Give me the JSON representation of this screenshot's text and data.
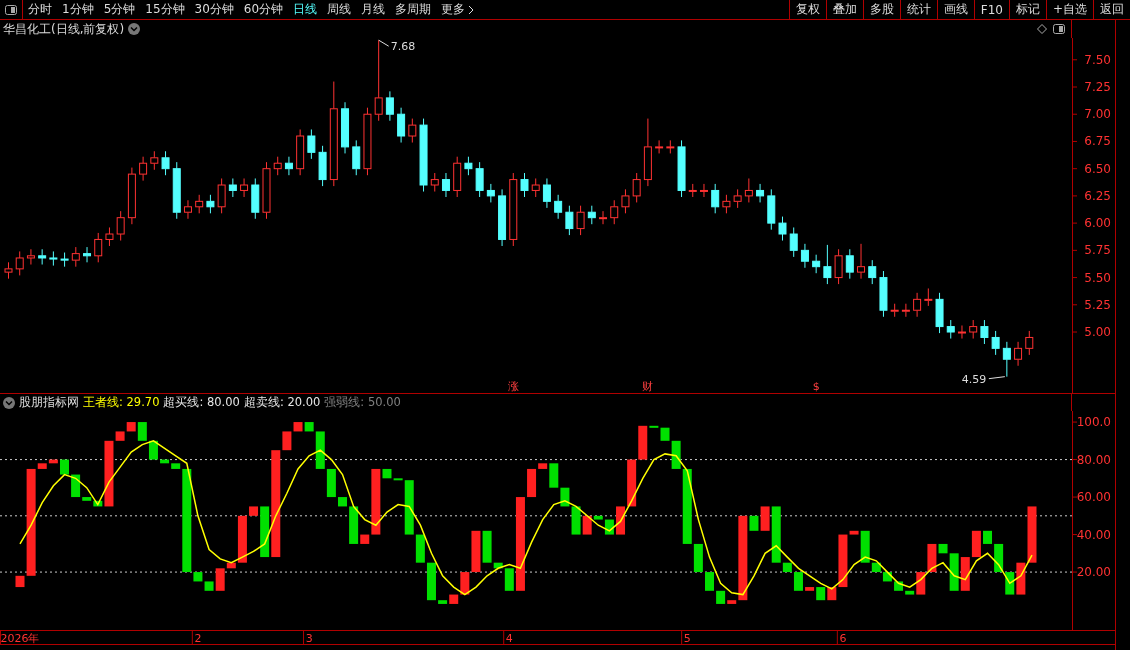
{
  "toolbar": {
    "periods": [
      {
        "label": "分时",
        "selected": false
      },
      {
        "label": "1分钟",
        "selected": false
      },
      {
        "label": "5分钟",
        "selected": false
      },
      {
        "label": "15分钟",
        "selected": false
      },
      {
        "label": "30分钟",
        "selected": false
      },
      {
        "label": "60分钟",
        "selected": false
      },
      {
        "label": "日线",
        "selected": true
      },
      {
        "label": "周线",
        "selected": false
      },
      {
        "label": "月线",
        "selected": false
      },
      {
        "label": "多周期",
        "selected": false
      },
      {
        "label": "更多",
        "selected": false
      }
    ],
    "buttons": [
      "复权",
      "叠加",
      "多股",
      "统计",
      "画线",
      "F10",
      "标记",
      "+自选",
      "返回"
    ]
  },
  "price_panel": {
    "title": "华昌化工(日线,前复权)",
    "high_label": "7.68",
    "low_label": "4.59",
    "events": [
      "涨",
      "财",
      "$"
    ],
    "chart_data": {
      "type": "candlestick",
      "ylim": [
        4.44,
        7.7
      ],
      "yticks": [
        {
          "value": 7.5,
          "label": "7.50"
        },
        {
          "value": 7.25,
          "label": "7.25"
        },
        {
          "value": 7.0,
          "label": "7.00"
        },
        {
          "value": 6.75,
          "label": "6.75"
        },
        {
          "value": 6.5,
          "label": "6.50"
        },
        {
          "value": 6.25,
          "label": "6.25"
        },
        {
          "value": 6.0,
          "label": "6.00"
        },
        {
          "value": 5.75,
          "label": "5.75"
        },
        {
          "value": 5.5,
          "label": "5.50"
        },
        {
          "value": 5.25,
          "label": "5.25"
        },
        {
          "value": 5.0,
          "label": "5.00"
        }
      ],
      "categories": [
        null,
        null,
        null,
        null,
        null,
        null,
        null,
        null,
        null,
        null,
        null,
        null,
        null,
        null,
        null,
        null,
        null,
        null,
        null,
        null,
        null,
        null,
        null,
        null,
        null,
        null,
        null,
        null,
        null,
        null,
        null,
        null,
        null,
        null,
        null,
        null,
        null,
        null,
        null,
        null,
        null,
        null,
        null,
        null,
        null,
        null,
        null,
        null,
        null,
        null,
        null,
        null,
        null,
        null,
        null,
        null,
        null,
        null,
        null,
        null,
        null,
        null,
        null,
        null,
        null,
        null,
        null,
        null,
        null,
        null,
        null,
        null,
        null,
        null,
        null,
        null,
        null,
        null,
        null,
        null,
        null,
        null,
        null,
        null,
        null,
        null,
        null,
        null,
        null,
        null,
        null,
        null
      ],
      "ohlc": [
        [
          5.55,
          5.64,
          5.49,
          5.58
        ],
        [
          5.58,
          5.74,
          5.52,
          5.68
        ],
        [
          5.68,
          5.76,
          5.62,
          5.7
        ],
        [
          5.7,
          5.76,
          5.62,
          5.68
        ],
        [
          5.68,
          5.74,
          5.61,
          5.67
        ],
        [
          5.67,
          5.73,
          5.6,
          5.66
        ],
        [
          5.66,
          5.78,
          5.6,
          5.72
        ],
        [
          5.72,
          5.78,
          5.64,
          5.7
        ],
        [
          5.7,
          5.91,
          5.64,
          5.85
        ],
        [
          5.85,
          5.96,
          5.79,
          5.9
        ],
        [
          5.9,
          6.11,
          5.84,
          6.05
        ],
        [
          6.05,
          6.51,
          5.99,
          6.45
        ],
        [
          6.45,
          6.61,
          6.39,
          6.55
        ],
        [
          6.55,
          6.66,
          6.49,
          6.6
        ],
        [
          6.6,
          6.66,
          6.44,
          6.5
        ],
        [
          6.5,
          6.56,
          6.04,
          6.1
        ],
        [
          6.1,
          6.21,
          6.04,
          6.15
        ],
        [
          6.15,
          6.26,
          6.09,
          6.2
        ],
        [
          6.2,
          6.26,
          6.09,
          6.15
        ],
        [
          6.15,
          6.41,
          6.09,
          6.35
        ],
        [
          6.35,
          6.41,
          6.24,
          6.3
        ],
        [
          6.3,
          6.41,
          6.24,
          6.35
        ],
        [
          6.35,
          6.41,
          6.04,
          6.1
        ],
        [
          6.1,
          6.56,
          6.04,
          6.5
        ],
        [
          6.5,
          6.61,
          6.44,
          6.55
        ],
        [
          6.55,
          6.61,
          6.44,
          6.5
        ],
        [
          6.5,
          6.86,
          6.44,
          6.8
        ],
        [
          6.8,
          6.86,
          6.59,
          6.65
        ],
        [
          6.65,
          6.71,
          6.34,
          6.4
        ],
        [
          6.4,
          7.3,
          6.34,
          7.05
        ],
        [
          7.05,
          7.11,
          6.64,
          6.7
        ],
        [
          6.7,
          6.76,
          6.44,
          6.5
        ],
        [
          6.5,
          7.06,
          6.44,
          7.0
        ],
        [
          7.0,
          7.68,
          6.94,
          7.15
        ],
        [
          7.15,
          7.21,
          6.94,
          7.0
        ],
        [
          7.0,
          7.06,
          6.74,
          6.8
        ],
        [
          6.8,
          6.96,
          6.74,
          6.9
        ],
        [
          6.9,
          6.96,
          6.29,
          6.35
        ],
        [
          6.35,
          6.46,
          6.29,
          6.4
        ],
        [
          6.4,
          6.46,
          6.24,
          6.3
        ],
        [
          6.3,
          6.61,
          6.24,
          6.55
        ],
        [
          6.55,
          6.61,
          6.44,
          6.5
        ],
        [
          6.5,
          6.56,
          6.24,
          6.3
        ],
        [
          6.3,
          6.36,
          6.19,
          6.25
        ],
        [
          6.25,
          6.31,
          5.79,
          5.85
        ],
        [
          5.85,
          6.46,
          5.79,
          6.4
        ],
        [
          6.4,
          6.46,
          6.24,
          6.3
        ],
        [
          6.3,
          6.41,
          6.24,
          6.35
        ],
        [
          6.35,
          6.41,
          6.14,
          6.2
        ],
        [
          6.2,
          6.26,
          6.04,
          6.1
        ],
        [
          6.1,
          6.16,
          5.89,
          5.95
        ],
        [
          5.95,
          6.16,
          5.89,
          6.1
        ],
        [
          6.1,
          6.16,
          5.99,
          6.05
        ],
        [
          6.05,
          6.11,
          5.99,
          6.05
        ],
        [
          6.05,
          6.21,
          5.99,
          6.15
        ],
        [
          6.15,
          6.31,
          6.09,
          6.25
        ],
        [
          6.25,
          6.46,
          6.19,
          6.4
        ],
        [
          6.4,
          6.96,
          6.34,
          6.7
        ],
        [
          6.7,
          6.76,
          6.64,
          6.7
        ],
        [
          6.7,
          6.76,
          6.64,
          6.7
        ],
        [
          6.7,
          6.76,
          6.24,
          6.3
        ],
        [
          6.3,
          6.36,
          6.24,
          6.3
        ],
        [
          6.3,
          6.36,
          6.24,
          6.3
        ],
        [
          6.3,
          6.36,
          6.09,
          6.15
        ],
        [
          6.15,
          6.26,
          6.09,
          6.2
        ],
        [
          6.2,
          6.31,
          6.14,
          6.25
        ],
        [
          6.25,
          6.41,
          6.19,
          6.3
        ],
        [
          6.3,
          6.36,
          6.19,
          6.25
        ],
        [
          6.25,
          6.31,
          5.94,
          6.0
        ],
        [
          6.0,
          6.06,
          5.84,
          5.9
        ],
        [
          5.9,
          5.96,
          5.69,
          5.75
        ],
        [
          5.75,
          5.81,
          5.59,
          5.65
        ],
        [
          5.65,
          5.71,
          5.54,
          5.6
        ],
        [
          5.6,
          5.8,
          5.44,
          5.5
        ],
        [
          5.5,
          5.76,
          5.44,
          5.7
        ],
        [
          5.7,
          5.76,
          5.49,
          5.55
        ],
        [
          5.55,
          5.81,
          5.49,
          5.6
        ],
        [
          5.6,
          5.66,
          5.44,
          5.5
        ],
        [
          5.5,
          5.56,
          5.14,
          5.2
        ],
        [
          5.2,
          5.26,
          5.14,
          5.2
        ],
        [
          5.2,
          5.26,
          5.14,
          5.2
        ],
        [
          5.2,
          5.36,
          5.14,
          5.3
        ],
        [
          5.3,
          5.4,
          5.24,
          5.3
        ],
        [
          5.3,
          5.36,
          4.99,
          5.05
        ],
        [
          5.05,
          5.11,
          4.94,
          5.0
        ],
        [
          5.0,
          5.06,
          4.94,
          5.0
        ],
        [
          5.0,
          5.11,
          4.94,
          5.05
        ],
        [
          5.05,
          5.11,
          4.89,
          4.95
        ],
        [
          4.95,
          5.01,
          4.79,
          4.85
        ],
        [
          4.85,
          4.91,
          4.59,
          4.75
        ],
        [
          4.75,
          4.91,
          4.69,
          4.85
        ],
        [
          4.85,
          5.01,
          4.79,
          4.95
        ]
      ]
    }
  },
  "indicator_panel": {
    "name": "股朋指标网",
    "readings": [
      {
        "label": "王者线: 29.70",
        "color": "#ffff00"
      },
      {
        "label": "超买线: 80.00",
        "color": "#e6e6e6"
      },
      {
        "label": "超卖线: 20.00",
        "color": "#e6e6e6"
      },
      {
        "label": "强弱线: 50.00",
        "color": "#808080"
      }
    ],
    "chart_data": {
      "type": "candlestick",
      "ylim": [
        -10.9,
        105.9
      ],
      "yticks": [
        {
          "value": 100,
          "label": "100.0"
        },
        {
          "value": 80,
          "label": "80.00"
        },
        {
          "value": 60,
          "label": "60.00"
        },
        {
          "value": 40,
          "label": "40.00"
        },
        {
          "value": 20,
          "label": "20.00"
        }
      ],
      "ref_lines": [
        {
          "axis": "y",
          "value": 80
        },
        {
          "axis": "y",
          "value": 50
        },
        {
          "axis": "y",
          "value": 20
        }
      ],
      "categories": [
        "2026年",
        null,
        null,
        null,
        null,
        null,
        null,
        null,
        null,
        null,
        null,
        null,
        null,
        null,
        null,
        null,
        "2",
        null,
        null,
        null,
        null,
        null,
        null,
        null,
        null,
        null,
        "3",
        null,
        null,
        null,
        null,
        null,
        null,
        null,
        null,
        null,
        null,
        null,
        null,
        null,
        null,
        null,
        null,
        null,
        "4",
        null,
        null,
        null,
        null,
        null,
        null,
        null,
        null,
        null,
        null,
        null,
        null,
        null,
        null,
        null,
        "5",
        null,
        null,
        null,
        null,
        null,
        null,
        null,
        null,
        null,
        null,
        null,
        null,
        null,
        "6",
        null,
        null,
        null,
        null,
        null,
        null,
        null,
        null,
        null,
        null,
        null,
        null,
        null,
        null,
        null,
        null,
        null
      ],
      "ohlc": [
        [
          12,
          18,
          12,
          18
        ],
        [
          18,
          75,
          18,
          75
        ],
        [
          75,
          78,
          75,
          78
        ],
        [
          78,
          80,
          78,
          80
        ],
        [
          80,
          80,
          72,
          72
        ],
        [
          72,
          72,
          60,
          60
        ],
        [
          60,
          60,
          58,
          58
        ],
        [
          58,
          58,
          55,
          55
        ],
        [
          55,
          90,
          55,
          90
        ],
        [
          90,
          95,
          90,
          95
        ],
        [
          95,
          100,
          95,
          100
        ],
        [
          100,
          100,
          90,
          90
        ],
        [
          90,
          90,
          80,
          80
        ],
        [
          80,
          80,
          78,
          78
        ],
        [
          78,
          78,
          75,
          75
        ],
        [
          75,
          75,
          20,
          20
        ],
        [
          20,
          20,
          15,
          15
        ],
        [
          15,
          15,
          10,
          10
        ],
        [
          10,
          22,
          10,
          22
        ],
        [
          22,
          25,
          22,
          25
        ],
        [
          25,
          50,
          25,
          50
        ],
        [
          50,
          55,
          50,
          55
        ],
        [
          55,
          55,
          28,
          28
        ],
        [
          28,
          85,
          28,
          85
        ],
        [
          85,
          95,
          85,
          95
        ],
        [
          95,
          100,
          95,
          100
        ],
        [
          100,
          100,
          95,
          95
        ],
        [
          95,
          95,
          75,
          75
        ],
        [
          75,
          75,
          60,
          60
        ],
        [
          60,
          60,
          55,
          55
        ],
        [
          55,
          55,
          35,
          35
        ],
        [
          35,
          40,
          35,
          40
        ],
        [
          40,
          75,
          40,
          75
        ],
        [
          75,
          75,
          70,
          70
        ],
        [
          70,
          70,
          69,
          69
        ],
        [
          69,
          69,
          40,
          40
        ],
        [
          40,
          40,
          25,
          25
        ],
        [
          25,
          25,
          5,
          5
        ],
        [
          5,
          5,
          3,
          3
        ],
        [
          3,
          8,
          3,
          8
        ],
        [
          8,
          20,
          8,
          20
        ],
        [
          20,
          42,
          20,
          42
        ],
        [
          42,
          42,
          25,
          25
        ],
        [
          25,
          25,
          22,
          22
        ],
        [
          22,
          22,
          10,
          10
        ],
        [
          10,
          60,
          10,
          60
        ],
        [
          60,
          75,
          60,
          75
        ],
        [
          75,
          78,
          75,
          78
        ],
        [
          78,
          78,
          65,
          65
        ],
        [
          65,
          65,
          55,
          55
        ],
        [
          55,
          55,
          40,
          40
        ],
        [
          40,
          50,
          40,
          50
        ],
        [
          50,
          50,
          48,
          48
        ],
        [
          48,
          48,
          40,
          40
        ],
        [
          40,
          55,
          40,
          55
        ],
        [
          55,
          80,
          55,
          80
        ],
        [
          80,
          98,
          80,
          98
        ],
        [
          98,
          98,
          97,
          97
        ],
        [
          97,
          97,
          90,
          90
        ],
        [
          90,
          90,
          75,
          75
        ],
        [
          75,
          75,
          35,
          35
        ],
        [
          35,
          35,
          20,
          20
        ],
        [
          20,
          20,
          10,
          10
        ],
        [
          10,
          10,
          3,
          3
        ],
        [
          3,
          5,
          3,
          5
        ],
        [
          5,
          50,
          5,
          50
        ],
        [
          50,
          50,
          42,
          42
        ],
        [
          42,
          55,
          42,
          55
        ],
        [
          55,
          55,
          25,
          25
        ],
        [
          25,
          25,
          20,
          20
        ],
        [
          20,
          20,
          10,
          10
        ],
        [
          10,
          12,
          10,
          12
        ],
        [
          12,
          12,
          5,
          5
        ],
        [
          5,
          12,
          5,
          12
        ],
        [
          12,
          40,
          12,
          40
        ],
        [
          40,
          42,
          40,
          42
        ],
        [
          42,
          42,
          25,
          25
        ],
        [
          25,
          25,
          20,
          20
        ],
        [
          20,
          20,
          15,
          15
        ],
        [
          15,
          15,
          10,
          10
        ],
        [
          10,
          10,
          8,
          8
        ],
        [
          8,
          20,
          8,
          20
        ],
        [
          20,
          35,
          20,
          35
        ],
        [
          35,
          35,
          30,
          30
        ],
        [
          30,
          30,
          10,
          10
        ],
        [
          10,
          28,
          10,
          28
        ],
        [
          28,
          42,
          28,
          42
        ],
        [
          42,
          42,
          35,
          35
        ],
        [
          35,
          35,
          20,
          20
        ],
        [
          20,
          20,
          8,
          8
        ],
        [
          8,
          25,
          8,
          25
        ],
        [
          25,
          55,
          25,
          55
        ]
      ],
      "series": [
        {
          "type": "line",
          "color": "#ffff00",
          "values": [
            35,
            45,
            57,
            66,
            72,
            70,
            65,
            56,
            68,
            76,
            84,
            88,
            90,
            86,
            82,
            78,
            50,
            32,
            27,
            25,
            28,
            31,
            35,
            50,
            62,
            75,
            82,
            85,
            80,
            72,
            55,
            48,
            45,
            52,
            56,
            55,
            45,
            30,
            18,
            12,
            8,
            12,
            18,
            22,
            24,
            22,
            36,
            48,
            56,
            58,
            55,
            50,
            45,
            42,
            47,
            58,
            70,
            80,
            83,
            82,
            74,
            48,
            28,
            14,
            9,
            8,
            18,
            30,
            34,
            28,
            22,
            18,
            14,
            11,
            16,
            24,
            28,
            26,
            20,
            14,
            12,
            16,
            22,
            25,
            18,
            16,
            26,
            30,
            24,
            14,
            18,
            29
          ]
        }
      ]
    }
  }
}
